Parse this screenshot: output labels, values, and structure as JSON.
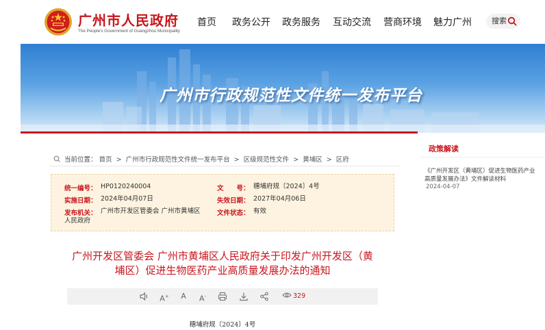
{
  "header": {
    "site_title": "广州市人民政府",
    "site_subtitle": "The People's Government of Guangzhou Municipality",
    "nav": [
      "首页",
      "政务公开",
      "政务服务",
      "互动交流",
      "营商环境",
      "魅力广州"
    ],
    "search_label": "搜索"
  },
  "banner": {
    "title": "广州市行政规范性文件统一发布平台"
  },
  "breadcrumb": {
    "prefix": "当前位置：",
    "items": [
      "首页",
      "广州市行政规范性文件统一发布平台",
      "区级规范性文件",
      "黄埔区",
      "区府"
    ],
    "separator": ">"
  },
  "info": {
    "serial_label": "统一编号：",
    "serial_value": "HP0120240004",
    "doc_label": "文　　号：",
    "doc_value": "穗埔府规〔2024〕4号",
    "impl_label": "实施日期：",
    "impl_value": "2024年04月07日",
    "expire_label": "失效日期：",
    "expire_value": "2027年04月06日",
    "issuer_label": "发布机关：",
    "issuer_value_1": "广州市开发区管委会 广州市黄埔区",
    "issuer_value_2": "人民政府",
    "status_label": "文件状态：",
    "status_value": "有效"
  },
  "document": {
    "title_line1": "广州开发区管委会 广州市黄埔区人民政府关于印发广州开发区（黄",
    "title_line2": "埔区）促进生物医药产业高质量发展办法的通知",
    "number": "穗埔府规〔2024〕4号"
  },
  "toolbar": {
    "font_up": "A",
    "font_normal": "A",
    "font_down": "A",
    "views": "329"
  },
  "sidebar": {
    "title": "政策解读",
    "link_text": "《广州开发区（黄埔区）促进生物医药产业高质量发展办法》文件解读材料",
    "link_date": "2024-04-07"
  },
  "colors": {
    "brand_red": "#c8161d",
    "info_bg": "#fdf3e0"
  }
}
